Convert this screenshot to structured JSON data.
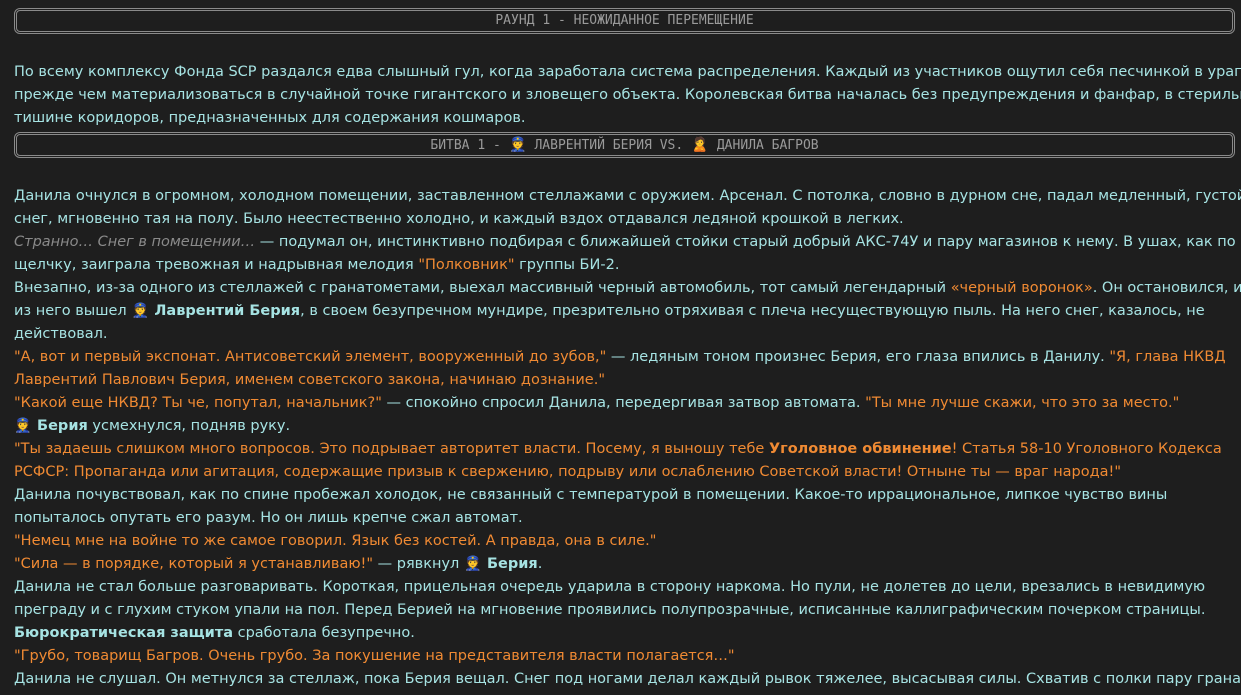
{
  "banner1": "РАУНД 1 - НЕОЖИДАННОЕ ПЕРЕМЕЩЕНИЕ",
  "banner2": {
    "prefix": "БИТВА 1 - ",
    "emoji1": "👮",
    "name1": " ЛАВРЕНТИЙ БЕРИЯ VS. ",
    "emoji2": "🙎",
    "name2": " ДАНИЛА БАГРОВ"
  },
  "intro": {
    "l1": "По всему комплексу Фонда SCP раздался едва слышный гул, когда заработала система распределения. Каждый из участников ощутил себя песчинкой в урагане,",
    "l2": "прежде чем материализоваться в случайной точке гигантского и зловещего объекта. Королевская битва началась без предупреждения и фанфар, в стерильной",
    "l3": "тишине коридоров, предназначенных для содержания кошмаров."
  },
  "story": {
    "s1": "Данила очнулся в огромном, холодном помещении, заставленном стеллажами с оружием. Арсенал. С потолка, словно в дурном сне, падал медленный, густой",
    "s2": "снег, мгновенно тая на полу. Было неестественно холодно, и каждый вздох отдавался ледяной крошкой в легких.",
    "s3_i": "Странно… Снег в помещении…",
    "s3_t": " — подумал он, инстинктивно подбирая с ближайшей стойки старый добрый АКС-74У и пару магазинов к нему. В ушах, как по",
    "s4_t": "щелчку, заиграла тревожная и надрывная мелодия ",
    "s4_q": "\"Полковник\"",
    "s4_t2": " группы БИ-2.",
    "s5_t": "Внезапно, из-за одного из стеллажей с гранатометами, выехал массивный черный автомобиль, тот самый легендарный ",
    "s5_q": "«черный воронок»",
    "s5_t2": ". Он остановился, и",
    "s6_t": "из него вышел ",
    "s6_e": "👮",
    "s6_b": " Лаврентий Берия",
    "s6_t2": ", в своем безупречном мундире, презрительно отряхивая с плеча несуществующую пыль. На него снег, казалось, не",
    "s7": "действовал.",
    "s8_q": "\"А, вот и первый экспонат. Антисоветский элемент, вооруженный до зубов,\"",
    "s8_t": " — ледяным тоном произнес Берия, его глаза впились в Данилу. ",
    "s8_q2": "\"Я, глава НКВД",
    "s9_q": "Лаврентий Павлович Берия, именем советского закона, начинаю дознание.\"",
    "s10_q": "\"Какой еще НКВД? Ты че, попутал, начальник?\"",
    "s10_t": " — спокойно спросил Данила, передергивая затвор автомата. ",
    "s10_q2": "\"Ты мне лучше скажи, что это за место.\"",
    "s11_e": "👮",
    "s11_b": " Берия",
    "s11_t": " усмехнулся, подняв руку.",
    "s12_q": "\"Ты задаешь слишком много вопросов. Это подрывает авторитет власти. Посему, я выношу тебе ",
    "s12_qb": "Уголовное обвинение",
    "s12_q2": "! Статья 58-10 Уголовного Кодекса",
    "s13_q": "РСФСР: Пропаганда или агитация, содержащие призыв к свержению, подрыву или ослаблению Советской власти! Отныне ты — враг народа!\"",
    "s14": "Данила почувствовал, как по спине пробежал холодок, не связанный с температурой в помещении. Какое-то иррациональное, липкое чувство вины",
    "s15": "попыталось опутать его разум. Но он лишь крепче сжал автомат.",
    "s16_q": "\"Немец мне на войне то же самое говорил. Язык без костей. А правда, она в силе.\"",
    "s17_q": "\"Сила — в порядке, который я устанавливаю!\"",
    "s17_t": " — рявкнул ",
    "s17_e": "👮",
    "s17_b": " Берия",
    "s17_t2": ".",
    "s18": "Данила не стал больше разговаривать. Короткая, прицельная очередь ударила в сторону наркома. Но пули, не долетев до цели, врезались в невидимую",
    "s19": "преграду и с глухим стуком упали на пол. Перед Берией на мгновение проявились полупрозрачные, исписанные каллиграфическим почерком страницы.",
    "s20_b": "Бюрократическая защита",
    "s20_t": " сработала безупречно.",
    "s21_q": "\"Грубо, товарищ Багров. Очень грубо. За покушение на представителя власти полагается…\"",
    "s22": "Данила не слушал. Он метнулся за стеллаж, пока Берия вещал. Снег под ногами делал каждый рывок тяжелее, высасывая силы. Схватив с полки пару гранат"
  }
}
